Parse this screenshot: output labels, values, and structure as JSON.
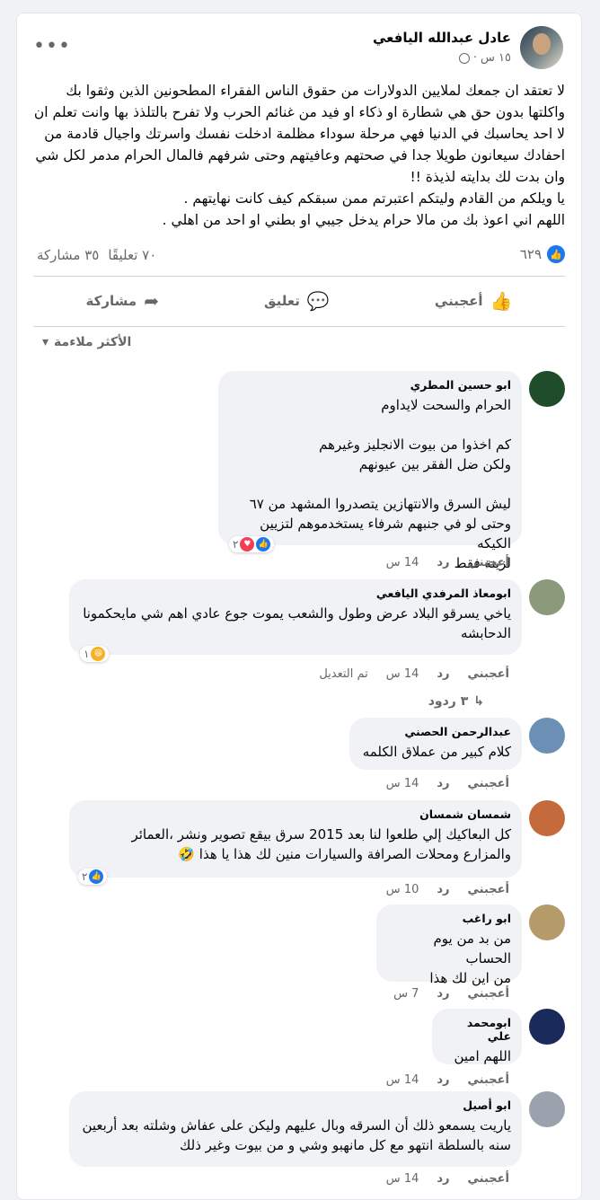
{
  "post": {
    "author": "عادل عبدالله اليافعي",
    "time": "١٥ س",
    "dot": "·",
    "text": "لا تعتقد ان جمعك لملايين الدولارات من حقوق الناس الفقراء المطحونين الذين وثقوا بك واكلتها بدون حق هي شطارة او ذكاء او فيد من غنائم الحرب ولا تفرح بالتلذذ بها وانت تعلم ان لا احد يحاسبك في الدنيا فهي مرحلة سوداء مظلمة ادخلت نفسك واسرتك واجيال قادمة من احفادك سيعانون طويلا جدا في صحتهم وعافيتهم وحتى شرفهم فالمال الحرام مدمر لكل شي وان بدت لك بدايته لذيذة !!\nيا ويلكم من القادم وليتكم اعتبرتم ممن سبقكم كيف كانت نهايتهم .\nاللهم اني اعوذ بك من مالا حرام يدخل جيبي او بطني او احد من اهلي .",
    "reactions_count": "٦٢٩",
    "comments_count": "٧٠ تعليقًا",
    "shares_count": "٣٥ مشاركة"
  },
  "actions": {
    "like": "أعجبني",
    "comment": "تعليق",
    "share": "مشاركة"
  },
  "sort_label": "الأكثر ملاءمة",
  "comment_actions": {
    "like": "أعجبني",
    "reply": "رد"
  },
  "comments": [
    {
      "name": "ابو حسين المطري",
      "text": "الحرام والسحت لايداوم\n\nكم اخذوا من بيوت الانجليز وغيرهم\nولكن ضل الفقر بين عيونهم\n\nليش السرق والانتهازين يتصدروا المشهد من ٦٧\nوحتى لو في جنبهم شرفاء يستخدموهم لتزيين الكيكه\nلزينة فقط",
      "time": "14 س",
      "reaction_count": "٢"
    },
    {
      "name": "ابومعاذ المرفدي اليافعي",
      "text": "ياخي يسرقو البلاد عرض وطول والشعب يموت جوع عادي اهم شي مايحكمونا الدحابشه",
      "time": "14 س",
      "edited": "تم التعديل",
      "reaction_count": "١",
      "replies": "٣ ردود"
    },
    {
      "name": "عبدالرحمن الحصني",
      "text": "كلام كبير من عملاق الكلمه",
      "time": "14 س"
    },
    {
      "name": "شمسان شمسان",
      "text": "كل البعاكيك إلي طلعوا لنا بعد 2015 سرق بيقع تصوير ونشر ،العمائر والمزارع ومحلات الصرافة والسيارات منين لك هذا يا هذا 🤣",
      "time": "10 س",
      "reaction_count": "٢"
    },
    {
      "name": "ابو راغب",
      "text": "من بد من يوم الحساب\nمن اين لك هذا",
      "time": "7 س"
    },
    {
      "name": "ابومحمد علي",
      "text": "اللهم امين",
      "time": "14 س"
    },
    {
      "name": "ابو أصيل",
      "text": "ياريت يسمعو ذلك أن السرقه وبال عليهم وليكن على عفاش وشلته بعد أربعين سنه بالسلطة انتهو مع كل مانهبو وشي و من بيوت وغير ذلك",
      "time": "14 س"
    }
  ]
}
